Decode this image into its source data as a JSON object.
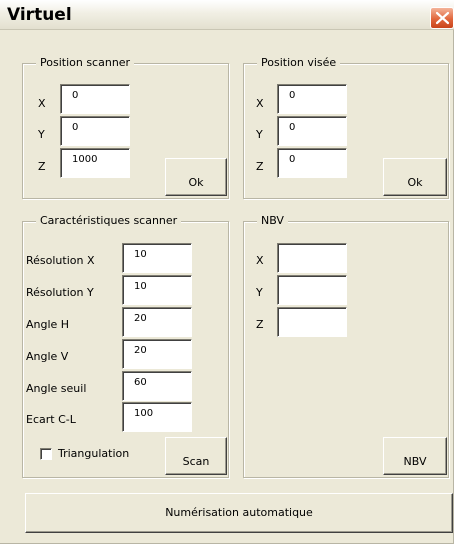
{
  "window": {
    "title": "Virtuel"
  },
  "position_scanner": {
    "legend": "Position scanner",
    "x_label": "X",
    "x_value": "0",
    "y_label": "Y",
    "y_value": "0",
    "z_label": "Z",
    "z_value": "1000",
    "ok_label": "Ok"
  },
  "position_visee": {
    "legend": "Position visée",
    "x_label": "X",
    "x_value": "0",
    "y_label": "Y",
    "y_value": "0",
    "z_label": "Z",
    "z_value": "0",
    "ok_label": "Ok"
  },
  "caracteristiques": {
    "legend": "Caractéristiques scanner",
    "resolution_x_label": "Résolution X",
    "resolution_x_value": "10",
    "resolution_y_label": "Résolution Y",
    "resolution_y_value": "10",
    "angle_h_label": "Angle H",
    "angle_h_value": "20",
    "angle_v_label": "Angle V",
    "angle_v_value": "20",
    "angle_seuil_label": "Angle seuil",
    "angle_seuil_value": "60",
    "ecart_label": "Ecart C-L",
    "ecart_value": "100",
    "triangulation_label": "Triangulation",
    "triangulation_checked": false,
    "scan_label": "Scan"
  },
  "nbv": {
    "legend": "NBV",
    "x_label": "X",
    "x_value": "",
    "y_label": "Y",
    "y_value": "",
    "z_label": "Z",
    "z_value": "",
    "button_label": "NBV"
  },
  "footer": {
    "auto_label": "Numérisation automatique"
  },
  "colors": {
    "dialog_bg": "#ece9d8",
    "close_button": "#e1663c",
    "title_text": "#000000"
  }
}
